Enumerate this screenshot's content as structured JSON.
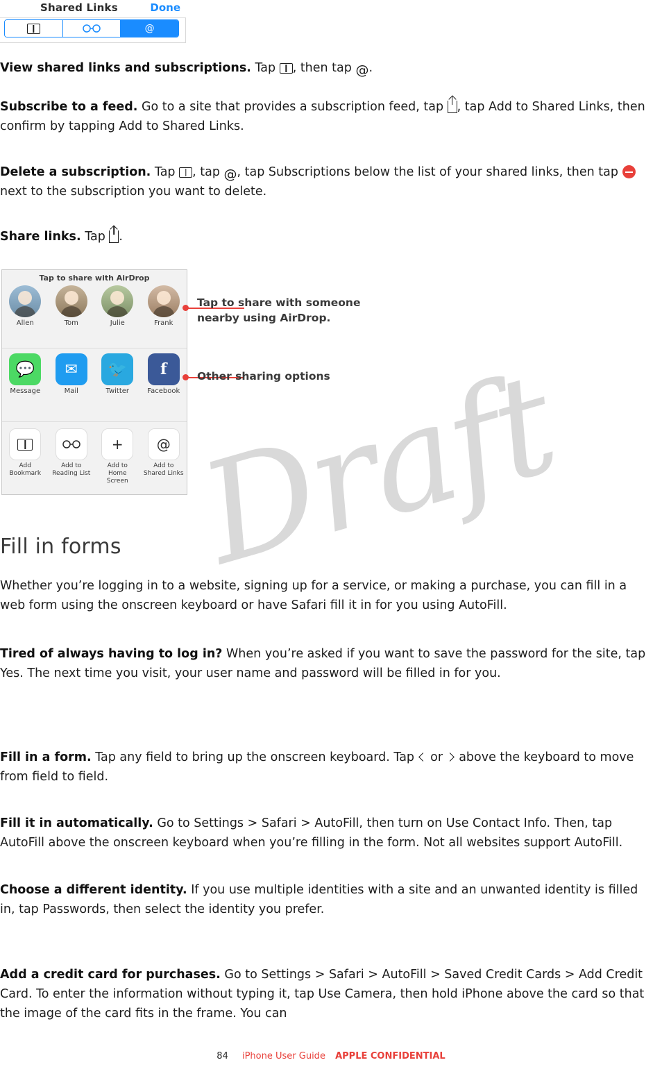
{
  "shared_links_shot": {
    "title": "Shared Links",
    "done_label": "Done",
    "tabs": [
      {
        "name": "bookmarks",
        "icon": "book-icon",
        "active": false
      },
      {
        "name": "reading-list",
        "icon": "glasses-icon",
        "active": false
      },
      {
        "name": "shared-links",
        "icon": "at-icon",
        "active": true
      }
    ]
  },
  "body": {
    "p1": {
      "lead": "View shared links and subscriptions.",
      "t1": " Tap ",
      "t2": ", then tap ",
      "t3": "."
    },
    "p2": {
      "lead": "Subscribe to a feed.",
      "t1": " Go to a site that provides a subscription feed, tap ",
      "t2": ", tap Add to Shared Links, then confirm by tapping Add to Shared Links."
    },
    "p3": {
      "lead": "Delete a subscription.",
      "t1": " Tap ",
      "t2": ", tap ",
      "t3": ", tap Subscriptions below the list of your shared links, then tap ",
      "t4": " next to the subscription you want to delete."
    },
    "p4": {
      "lead": "Share links.",
      "t1": " Tap ",
      "t2": "."
    }
  },
  "figure": {
    "airdrop_header": "Tap to share with AirDrop",
    "people": [
      {
        "name": "Allen"
      },
      {
        "name": "Tom"
      },
      {
        "name": "Julie"
      },
      {
        "name": "Frank"
      }
    ],
    "apps": [
      {
        "name": "Message",
        "glyph": "▢"
      },
      {
        "name": "Mail",
        "glyph": "✉"
      },
      {
        "name": "Twitter",
        "glyph": "❧"
      },
      {
        "name": "Facebook",
        "glyph": "f"
      }
    ],
    "actions": [
      {
        "line1": "Add",
        "line2": "Bookmark",
        "icon": "book-icon"
      },
      {
        "line1": "Add to",
        "line2": "Reading List",
        "icon": "glasses-icon"
      },
      {
        "line1": "Add to",
        "line2": "Home Screen",
        "icon": "plus-icon"
      },
      {
        "line1": "Add to",
        "line2": "Shared Links",
        "icon": "at-icon"
      }
    ],
    "callout_1": "Tap to share with someone nearby using AirDrop.",
    "callout_2": "Other sharing options"
  },
  "section": {
    "heading": "Fill in forms",
    "intro": "Whether you’re logging in to a website, signing up for a service, or making a purchase, you can fill in a web form using the onscreen keyboard or have Safari fill it in for you using AutoFill.",
    "p1": {
      "lead": "Tired of always having to log in?",
      "text": " When you’re asked if you want to save the password for the site, tap Yes. The next time you visit, your user name and password will be filled in for you."
    },
    "p2": {
      "lead": "Fill in a form.",
      "t1": " Tap any field to bring up the onscreen keyboard. Tap ",
      "t2": " or ",
      "t3": " above the keyboard to move from field to field."
    },
    "p3": {
      "lead": "Fill it in automatically.",
      "text": " Go to Settings > Safari > AutoFill, then turn on Use Contact Info. Then, tap AutoFill above the onscreen keyboard when you’re filling in the form. Not all websites support AutoFill."
    },
    "p4": {
      "lead": "Choose a different identity.",
      "text": " If you use multiple identities with a site and an unwanted identity is filled in, tap Passwords, then select the identity you prefer."
    },
    "p5": {
      "lead": "Add a credit card for purchases.",
      "text": " Go to Settings > Safari > AutoFill > Saved Credit Cards > Add Credit Card. To enter the information without typing it, tap Use Camera, then hold iPhone above the card so that the image of the card fits in the frame. You can"
    }
  },
  "watermark": "Draft",
  "footer": {
    "page_number": "84",
    "guide": "iPhone User Guide",
    "confidential": "APPLE CONFIDENTIAL"
  },
  "colors": {
    "accent_blue": "#1a8cff",
    "red": "#e8403a",
    "text": "#1d1d1d"
  }
}
